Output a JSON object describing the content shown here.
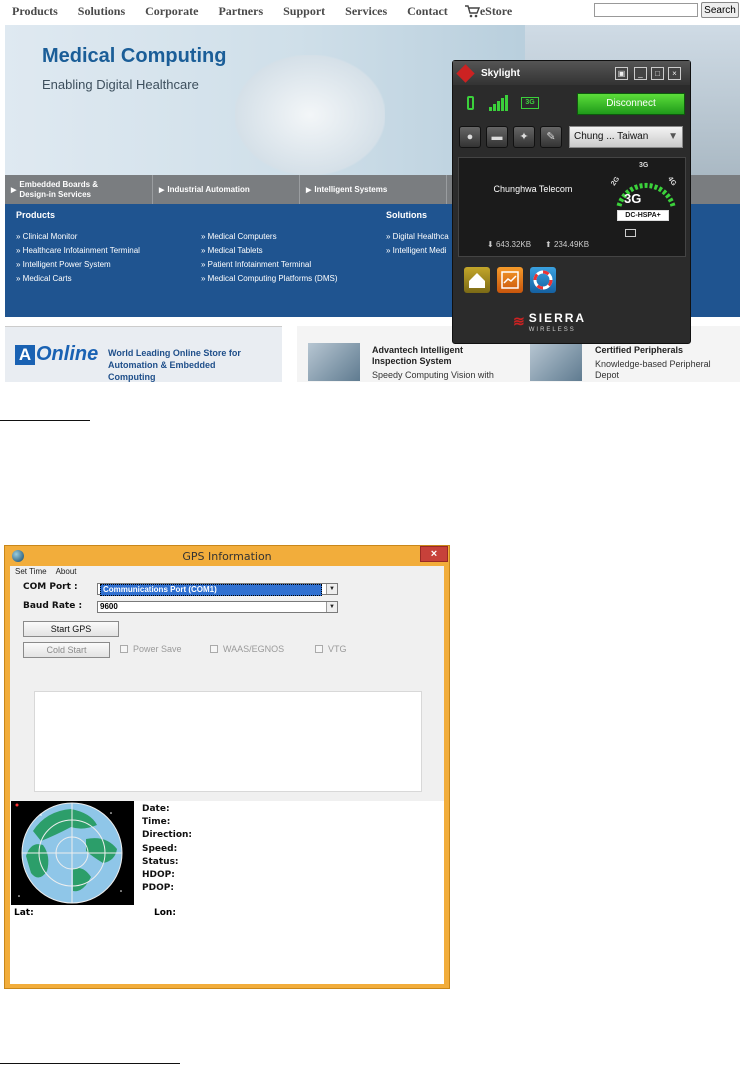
{
  "website": {
    "nav": [
      "Products",
      "Solutions",
      "Corporate",
      "Partners",
      "Support",
      "Services",
      "Contact"
    ],
    "estore": "eStore",
    "search_button": "Search",
    "hero_title": "Medical Computing",
    "hero_subtitle": "Enabling Digital Healthcare",
    "categories": [
      "Embedded Boards & Design-in Services",
      "Industrial Automation",
      "Intelligent Systems"
    ],
    "products_heading": "Products",
    "solutions_heading": "Solutions",
    "product_links_col1": [
      "Clinical Monitor",
      "Healthcare Infotainment Terminal",
      "Intelligent Power System",
      "Medical Carts"
    ],
    "product_links_col2": [
      "Medical Computers",
      "Medical Tablets",
      "Patient Infotainment Terminal",
      "Medical Computing Platforms (DMS)"
    ],
    "solution_links": [
      "Digital Healthca",
      "Intelligent Medi"
    ],
    "aonline_logo": "Online",
    "aonline_logo_a": "A",
    "aonline_text": "World Leading Online Store for Automation & Embedded Computing",
    "promo1_title": "Advantech Intelligent Inspection System",
    "promo1_sub": "Speedy Computing Vision with",
    "promo2_title": "Certified Peripherals",
    "promo2_sub": "Knowledge-based Peripheral Depot"
  },
  "skylight": {
    "title": "Skylight",
    "badge_3g": "3G",
    "disconnect_label": "Disconnect",
    "network_select": "Chung ... Taiwan",
    "carrier": "Chunghwa Telecom",
    "download": "643.32KB",
    "upload": "234.49KB",
    "gauge_label": "3G",
    "gauge_small": "3G",
    "gauge_left": "2G",
    "gauge_right": "4G",
    "technology": "DC-HSPA+",
    "brand_top": "SIERRA",
    "brand_bottom": "WIRELESS",
    "signal_bars": 5
  },
  "gps": {
    "title": "GPS Information",
    "close_label": "×",
    "menu": [
      "Set Time",
      "About"
    ],
    "com_port_label": "COM Port :",
    "com_port_value": "Communications Port (COM1)",
    "baud_rate_label": "Baud Rate :",
    "baud_rate_value": "9600",
    "start_button": "Start GPS",
    "cold_button": "Cold Start",
    "checks": [
      "Power Save",
      "WAAS/EGNOS",
      "VTG"
    ],
    "info_labels": [
      "Date:",
      "Time:",
      "Direction:",
      "Speed:",
      "Status:",
      "HDOP:",
      "PDOP:"
    ],
    "lat_label": "Lat:",
    "lon_label": "Lon:"
  },
  "colors": {
    "gps_frame": "#f2ad3b",
    "site_blue": "#1f5490",
    "skylight_green": "#3bd13b",
    "close_red": "#c7413a"
  }
}
